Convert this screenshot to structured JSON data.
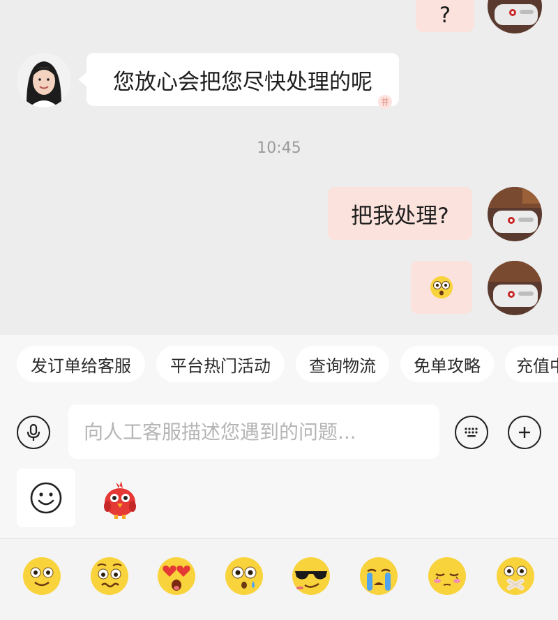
{
  "chat": {
    "messages": [
      {
        "side": "right",
        "text": "?"
      },
      {
        "side": "left",
        "text": "您放心会把您尽快处理的呢"
      },
      {
        "side": "right",
        "text": "把我处理?"
      },
      {
        "side": "right",
        "text": "",
        "emoji": "flushed-face"
      }
    ],
    "timestamp": "10:45"
  },
  "quick_replies": [
    "发订单给客服",
    "平台热门活动",
    "查询物流",
    "免单攻略",
    "充值中"
  ],
  "input": {
    "placeholder": "向人工客服描述您遇到的问题..."
  },
  "icons": {
    "voice": "microphone-icon",
    "keyboard": "keyboard-icon",
    "more": "plus-icon",
    "emoji_tab": "smiley-icon",
    "sticker_tab": "red-bird-mascot-icon"
  },
  "emoji_panel": [
    "smiling-face",
    "woozy-face",
    "heart-eyes-face",
    "flushed-face",
    "sunglasses-face",
    "crying-face",
    "closed-eyes-face",
    "zipped-mouth-face"
  ],
  "colors": {
    "background": "#ededed",
    "my_bubble": "#fbe2dc",
    "their_bubble": "#ffffff",
    "chip_bg": "#ffffff",
    "emoji_yellow": "#f9d33b"
  }
}
